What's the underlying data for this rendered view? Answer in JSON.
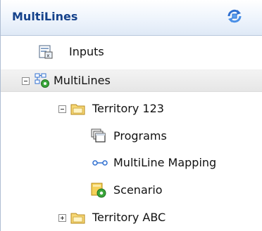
{
  "panel": {
    "title": "MultiLines"
  },
  "tree": {
    "inputs": {
      "label": "Inputs",
      "icon": "form-icon"
    },
    "multilines": {
      "label": "MultiLines",
      "icon": "network-gear-icon",
      "expanded": true,
      "selected": true
    },
    "territory_123": {
      "label": "Territory 123",
      "icon": "folder-icon",
      "expanded": true
    },
    "programs": {
      "label": "Programs",
      "icon": "stacked-windows-icon"
    },
    "multiline_mapping": {
      "label": "MultiLine Mapping",
      "icon": "mapping-link-icon"
    },
    "scenario": {
      "label": "Scenario",
      "icon": "scenario-gear-icon"
    },
    "territory_abc": {
      "label": "Territory ABC",
      "icon": "folder-icon",
      "expanded": false
    }
  },
  "colors": {
    "header_text": "#15428b",
    "folder": "#f2c94c",
    "gear": "#3aa63a"
  }
}
